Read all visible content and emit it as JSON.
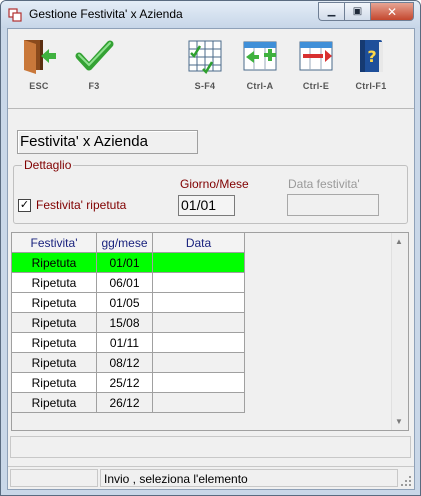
{
  "window": {
    "title": "Gestione Festivita' x Azienda"
  },
  "toolbar": {
    "items": [
      {
        "label": "ESC",
        "icon": "exit-door-icon"
      },
      {
        "label": "F3",
        "icon": "checkmark-icon"
      },
      {
        "label": "S-F4",
        "icon": "grid-check-icon"
      },
      {
        "label": "Ctrl-A",
        "icon": "add-row-icon"
      },
      {
        "label": "Ctrl-E",
        "icon": "remove-row-icon"
      },
      {
        "label": "Ctrl-F1",
        "icon": "help-book-icon"
      }
    ]
  },
  "panel": {
    "title": "Festivita' x Azienda"
  },
  "dettaglio": {
    "legend": "Dettaglio",
    "checkbox_label": "Festivita' ripetuta",
    "checkbox_checked": true,
    "checkbox_glyph": "✓",
    "giorno_label": "Giorno/Mese",
    "giorno_value": "01/01",
    "data_label": "Data festivita'",
    "data_value": ""
  },
  "grid": {
    "columns": [
      "Festivita'",
      "gg/mese",
      "Data"
    ],
    "rows": [
      {
        "festivita": "Ripetuta",
        "ggmese": "01/01",
        "data": ""
      },
      {
        "festivita": "Ripetuta",
        "ggmese": "06/01",
        "data": ""
      },
      {
        "festivita": "Ripetuta",
        "ggmese": "01/05",
        "data": ""
      },
      {
        "festivita": "Ripetuta",
        "ggmese": "15/08",
        "data": ""
      },
      {
        "festivita": "Ripetuta",
        "ggmese": "01/11",
        "data": ""
      },
      {
        "festivita": "Ripetuta",
        "ggmese": "08/12",
        "data": ""
      },
      {
        "festivita": "Ripetuta",
        "ggmese": "25/12",
        "data": ""
      },
      {
        "festivita": "Ripetuta",
        "ggmese": "26/12",
        "data": ""
      }
    ],
    "selected_index": 0,
    "selected_color": "#00ff00"
  },
  "status": {
    "text": "Invio , seleziona l'elemento"
  }
}
